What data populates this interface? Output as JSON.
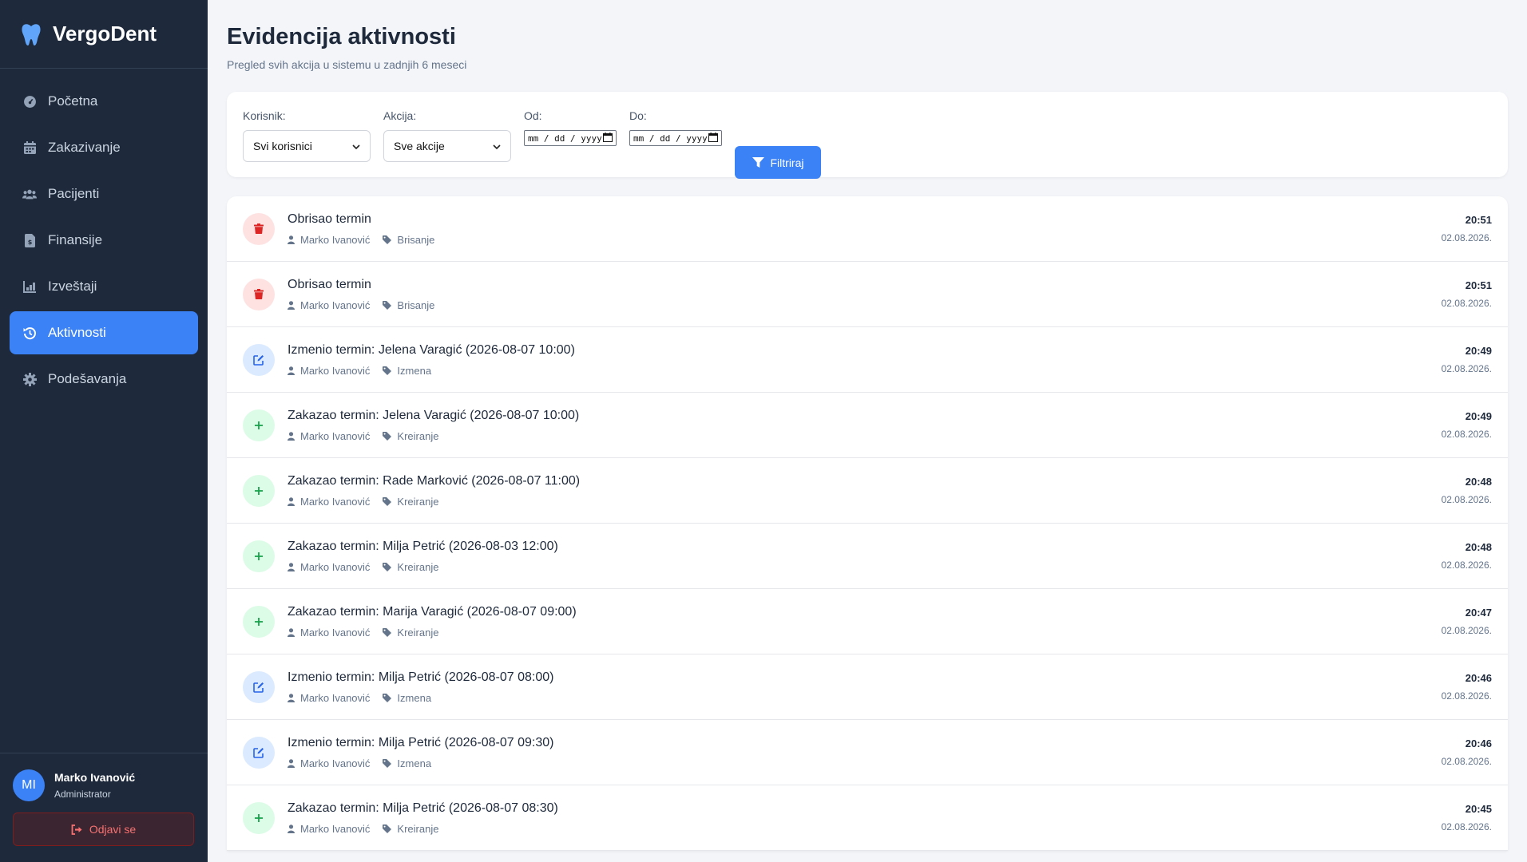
{
  "brand": {
    "name": "VergoDent"
  },
  "nav": [
    {
      "label": "Početna",
      "icon": "dashboard-icon"
    },
    {
      "label": "Zakazivanje",
      "icon": "calendar-icon"
    },
    {
      "label": "Pacijenti",
      "icon": "users-icon"
    },
    {
      "label": "Finansije",
      "icon": "invoice-icon"
    },
    {
      "label": "Izveštaji",
      "icon": "chart-icon"
    },
    {
      "label": "Aktivnosti",
      "icon": "history-icon",
      "active": true
    },
    {
      "label": "Podešavanja",
      "icon": "gear-icon"
    }
  ],
  "user": {
    "initials": "MI",
    "name": "Marko Ivanović",
    "role": "Administrator",
    "logout_label": "Odjavi se"
  },
  "page": {
    "title": "Evidencija aktivnosti",
    "subtitle": "Pregled svih akcija u sistemu u zadnjih 6 meseci"
  },
  "filters": {
    "user_label": "Korisnik:",
    "user_value": "Svi korisnici",
    "action_label": "Akcija:",
    "action_value": "Sve akcije",
    "from_label": "Od:",
    "from_placeholder": "mm / dd / yyyy",
    "to_label": "Do:",
    "to_placeholder": "mm / dd / yyyy",
    "button_label": "Filtriraj"
  },
  "activities": [
    {
      "type": "del",
      "title": "Obrisao termin",
      "user": "Marko Ivanović",
      "tag": "Brisanje",
      "time": "20:51",
      "date": "02.08.2026."
    },
    {
      "type": "del",
      "title": "Obrisao termin",
      "user": "Marko Ivanović",
      "tag": "Brisanje",
      "time": "20:51",
      "date": "02.08.2026."
    },
    {
      "type": "edit",
      "title": "Izmenio termin: Jelena Varagić (2026-08-07 10:00)",
      "user": "Marko Ivanović",
      "tag": "Izmena",
      "time": "20:49",
      "date": "02.08.2026."
    },
    {
      "type": "add",
      "title": "Zakazao termin: Jelena Varagić (2026-08-07 10:00)",
      "user": "Marko Ivanović",
      "tag": "Kreiranje",
      "time": "20:49",
      "date": "02.08.2026."
    },
    {
      "type": "add",
      "title": "Zakazao termin: Rade Marković (2026-08-07 11:00)",
      "user": "Marko Ivanović",
      "tag": "Kreiranje",
      "time": "20:48",
      "date": "02.08.2026."
    },
    {
      "type": "add",
      "title": "Zakazao termin: Milja Petrić (2026-08-03 12:00)",
      "user": "Marko Ivanović",
      "tag": "Kreiranje",
      "time": "20:48",
      "date": "02.08.2026."
    },
    {
      "type": "add",
      "title": "Zakazao termin: Marija Varagić (2026-08-07 09:00)",
      "user": "Marko Ivanović",
      "tag": "Kreiranje",
      "time": "20:47",
      "date": "02.08.2026."
    },
    {
      "type": "edit",
      "title": "Izmenio termin: Milja Petrić (2026-08-07 08:00)",
      "user": "Marko Ivanović",
      "tag": "Izmena",
      "time": "20:46",
      "date": "02.08.2026."
    },
    {
      "type": "edit",
      "title": "Izmenio termin: Milja Petrić (2026-08-07 09:30)",
      "user": "Marko Ivanović",
      "tag": "Izmena",
      "time": "20:46",
      "date": "02.08.2026."
    },
    {
      "type": "add",
      "title": "Zakazao termin: Milja Petrić (2026-08-07 08:30)",
      "user": "Marko Ivanović",
      "tag": "Kreiranje",
      "time": "20:45",
      "date": "02.08.2026."
    }
  ],
  "colors": {
    "accent": "#3b82f6",
    "sidebar": "#1e293b",
    "delete": "#dc2626",
    "edit": "#2563eb",
    "add": "#16a34a"
  }
}
